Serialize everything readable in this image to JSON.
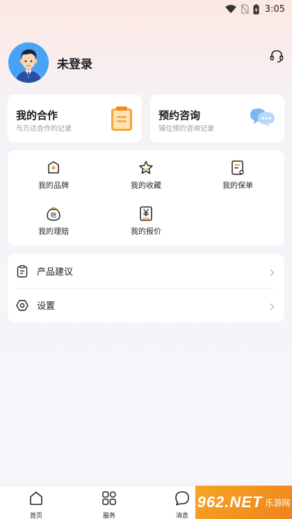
{
  "status_bar": {
    "time": "3:05",
    "icons": [
      "wifi-icon",
      "no-sim-icon",
      "battery-charging-icon"
    ]
  },
  "profile": {
    "name": "未登录",
    "support_icon": "headset-icon"
  },
  "cards": {
    "cooperation": {
      "title": "我的合作",
      "subtitle": "与万达合作的记录",
      "icon": "notepad-icon"
    },
    "appointment": {
      "title": "预约咨询",
      "subtitle": "铺位预约咨询记录",
      "icon": "chat-bubble-icon"
    }
  },
  "grid": [
    {
      "label": "我的品牌",
      "icon": "brand-tag-icon"
    },
    {
      "label": "我的收藏",
      "icon": "star-icon"
    },
    {
      "label": "我的保单",
      "icon": "policy-doc-icon"
    },
    {
      "label": "我的理赔",
      "icon": "claim-bag-icon"
    },
    {
      "label": "我的报价",
      "icon": "quote-yen-icon"
    }
  ],
  "list": [
    {
      "label": "产品建议",
      "icon": "clipboard-icon"
    },
    {
      "label": "设置",
      "icon": "settings-icon"
    }
  ],
  "tabbar": [
    {
      "label": "首页",
      "icon": "home-icon"
    },
    {
      "label": "服务",
      "icon": "services-grid-icon"
    },
    {
      "label": "消息",
      "icon": "message-icon"
    }
  ],
  "watermark": {
    "text": "962.NET",
    "subtext": "乐游网"
  },
  "colors": {
    "accent_orange": "#f3a43a",
    "avatar_blue": "#4aa2f5",
    "chat_blue": "#8cc0f5"
  }
}
